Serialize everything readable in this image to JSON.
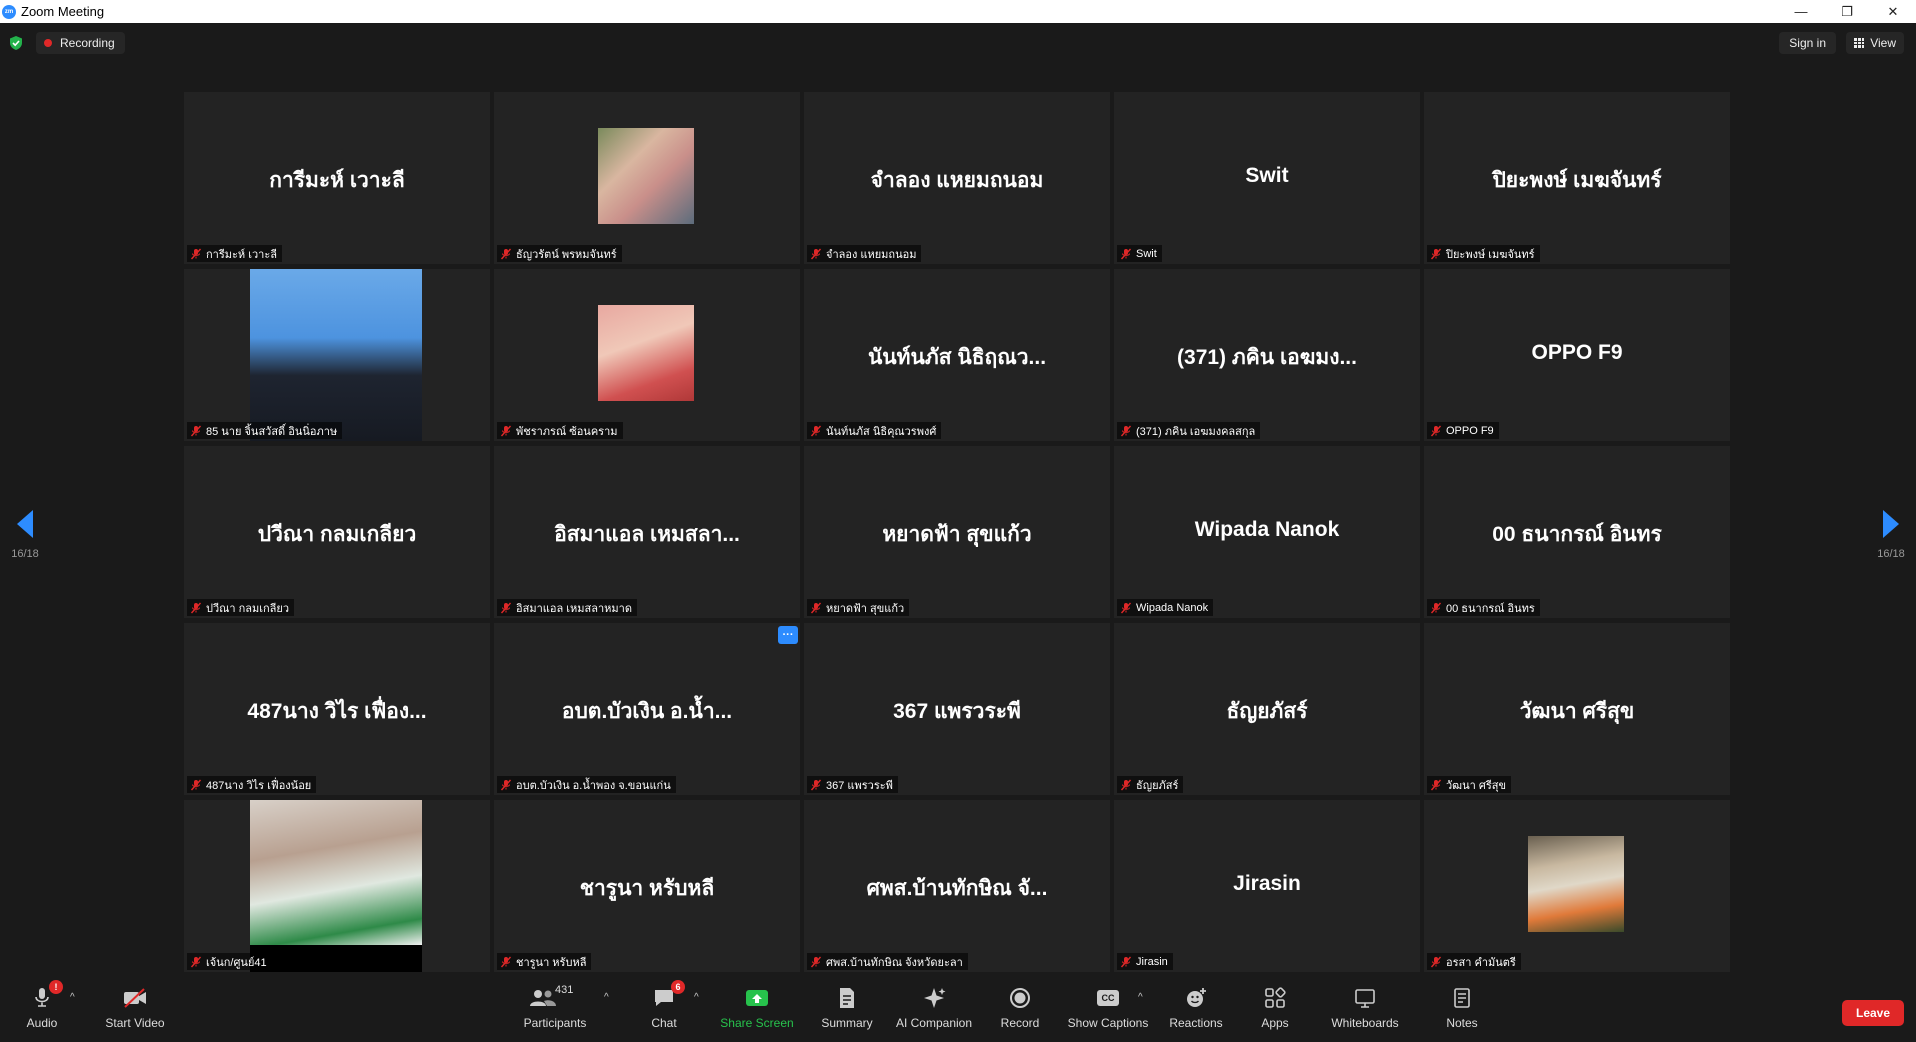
{
  "window": {
    "title": "Zoom Meeting",
    "logo": "zm",
    "minimize": "—",
    "restore": "❐",
    "close": "✕"
  },
  "topbar": {
    "recording": "Recording",
    "sign_in": "Sign in",
    "view": "View"
  },
  "pagination": {
    "left": "16/18",
    "right": "16/18"
  },
  "tiles": [
    {
      "name": "การีมะห์ เวาะลี",
      "label": "การีมะห์ เวาะลี"
    },
    {
      "name": "",
      "label": "ธัญวรัตน์ พรหมจันทร์"
    },
    {
      "name": "จำลอง แหยมถนอม",
      "label": "จำลอง แหยมถนอม"
    },
    {
      "name": "Swit",
      "label": "Swit"
    },
    {
      "name": "ปิยะพงษ์ เมฆจันทร์",
      "label": "ปิยะพงษ์ เมฆจันทร์"
    },
    {
      "name": "",
      "label": "85 นาย จิ้นสวัสดิ์ อินนิ่อภาษ"
    },
    {
      "name": "",
      "label": "พัชราภรณ์ ซ้อนคราม"
    },
    {
      "name": "นันท์นภัส นิธิฤณว...",
      "label": "นันท์นภัส นิธิคุณวรพงศ์"
    },
    {
      "name": "(371) ภคิน เอฆมง...",
      "label": "(371) ภคิน เอฆมงคลสกุล"
    },
    {
      "name": "OPPO F9",
      "label": "OPPO F9"
    },
    {
      "name": "ปวีณา กลมเกลียว",
      "label": "ปวีณา กลมเกลียว"
    },
    {
      "name": "อิสมาแอล เหมสลา...",
      "label": "อิสมาแอล เหมสลาหมาด"
    },
    {
      "name": "หยาดฟ้า สุขแก้ว",
      "label": "หยาดฟ้า สุขแก้ว"
    },
    {
      "name": "Wipada Nanok",
      "label": "Wipada Nanok"
    },
    {
      "name": "00 ธนากรณ์ อินทร",
      "label": "00 ธนากรณ์ อินทร"
    },
    {
      "name": "487นาง วิไร เฟื่อง...",
      "label": "487นาง วิไร เฟื่องน้อย"
    },
    {
      "name": "อบต.บัวเงิน อ.น้ำ...",
      "label": "อบต.บัวเงิน อ.น้ำพอง จ.ขอนแก่น",
      "more": "···"
    },
    {
      "name": "367 แพรวระพี",
      "label": "367 แพรวระพี"
    },
    {
      "name": "ธัญยภัสร์",
      "label": "ธัญยภัสร์"
    },
    {
      "name": "วัฒนา ศรีสุข",
      "label": "วัฒนา ศรีสุข"
    },
    {
      "name": "",
      "label": "เจ้นก/ศูนย์41"
    },
    {
      "name": "ชารูนา หรับหลี",
      "label": "ชารูนา หรับหลี"
    },
    {
      "name": "ศพส.บ้านทักษิณ จั...",
      "label": "ศพส.บ้านทักษิณ จังหวัดยะลา"
    },
    {
      "name": "Jirasin",
      "label": "Jirasin"
    },
    {
      "name": "",
      "label": "อรสา คำมันตรี"
    }
  ],
  "toolbar": {
    "audio": "Audio",
    "audio_badge": "!",
    "start_video": "Start Video",
    "participants": "Participants",
    "participants_count": "431",
    "chat": "Chat",
    "chat_badge": "6",
    "share_screen": "Share Screen",
    "summary": "Summary",
    "ai_companion": "AI Companion",
    "record": "Record",
    "show_captions": "Show Captions",
    "cc": "CC",
    "reactions": "Reactions",
    "apps": "Apps",
    "whiteboards": "Whiteboards",
    "notes": "Notes",
    "leave": "Leave",
    "caret": "^"
  },
  "colors": {
    "accent": "#2d8cff",
    "danger": "#e02828",
    "share": "#27c24c",
    "tile_bg": "#232323",
    "bg": "#1a1a1a"
  }
}
